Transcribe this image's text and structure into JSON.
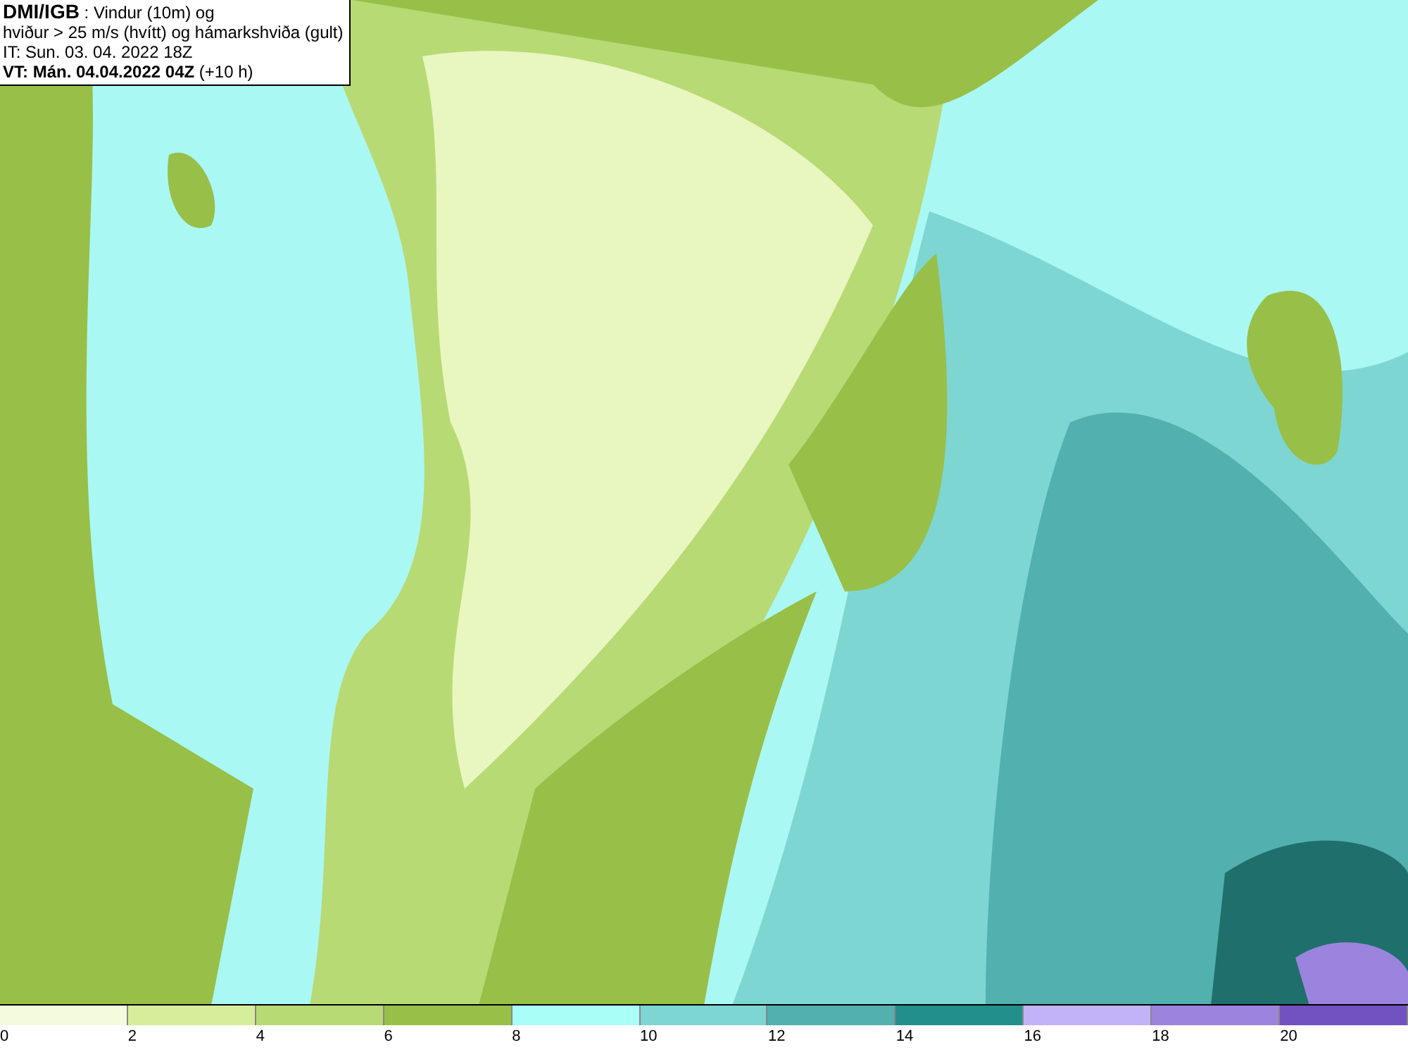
{
  "header": {
    "title": "DMI/IGB",
    "title_rest": " : Vindur (10m) og",
    "line_2": "hviður > 25 m/s (hvítt) og hámarkshviða (gult)",
    "line_3": "IT: Sun. 03. 04. 2022 18Z",
    "line_4": "**VT: Mán. 04.04.2022 04Z** (+10 h)"
  },
  "legend": [
    {
      "color": "#f4fbdc",
      "label": "0"
    },
    {
      "color": "#d6ee9c",
      "label": "2"
    },
    {
      "color": "#b8da74",
      "label": "4"
    },
    {
      "color": "#98bf48",
      "label": "6"
    },
    {
      "color": "#aafef8",
      "label": "8"
    },
    {
      "color": "#7ed6d2",
      "label": "10"
    },
    {
      "color": "#52b0ae",
      "label": "12"
    },
    {
      "color": "#228f8c",
      "label": "14"
    },
    {
      "color": "#c2b2f6",
      "label": "16"
    },
    {
      "color": "#9a84de",
      "label": "18"
    },
    {
      "color": "#7252c0",
      "label": "20"
    }
  ]
}
